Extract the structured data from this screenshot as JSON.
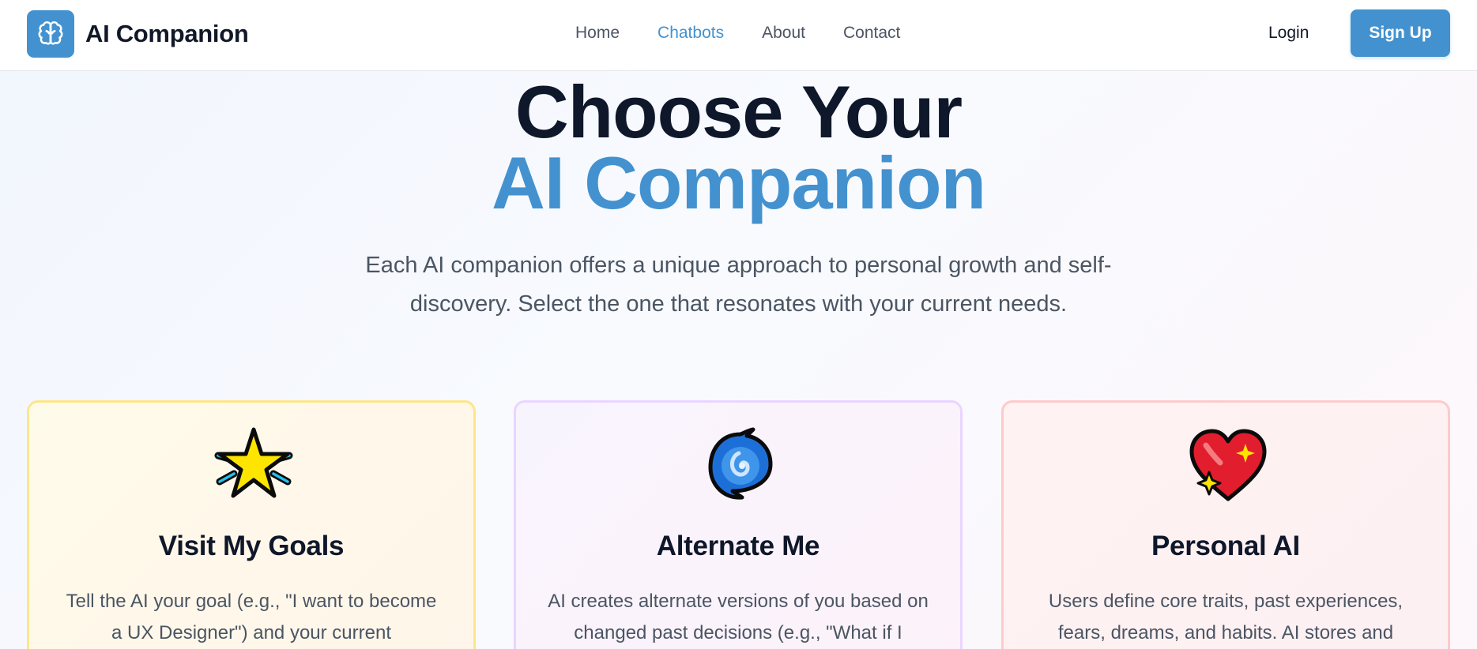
{
  "nav": {
    "brand": "AI Companion",
    "links": [
      {
        "label": "Home",
        "active": false
      },
      {
        "label": "Chatbots",
        "active": true
      },
      {
        "label": "About",
        "active": false
      },
      {
        "label": "Contact",
        "active": false
      }
    ],
    "login_label": "Login",
    "signup_label": "Sign Up",
    "logo_icon": "brain-icon",
    "accent_color": "#4392cf"
  },
  "hero": {
    "title_line1": "Choose Your",
    "title_line2": "AI Companion",
    "subtitle": "Each AI companion offers a unique approach to personal growth and self-discovery. Select the one that resonates with your current needs."
  },
  "cards": [
    {
      "icon": "glowing-star-icon",
      "title": "Visit My Goals",
      "text": "Tell the AI your goal (e.g., \"I want to become a UX Designer\") and your current",
      "color": "#fde68a"
    },
    {
      "icon": "cyclone-icon",
      "title": "Alternate Me",
      "text": "AI creates alternate versions of you based on changed past decisions (e.g., \"What if I",
      "color": "#e9d5ff"
    },
    {
      "icon": "sparkling-heart-icon",
      "title": "Personal AI",
      "text": "Users define core traits, past experiences, fears, dreams, and habits. AI stores and",
      "color": "#fecaca"
    }
  ]
}
